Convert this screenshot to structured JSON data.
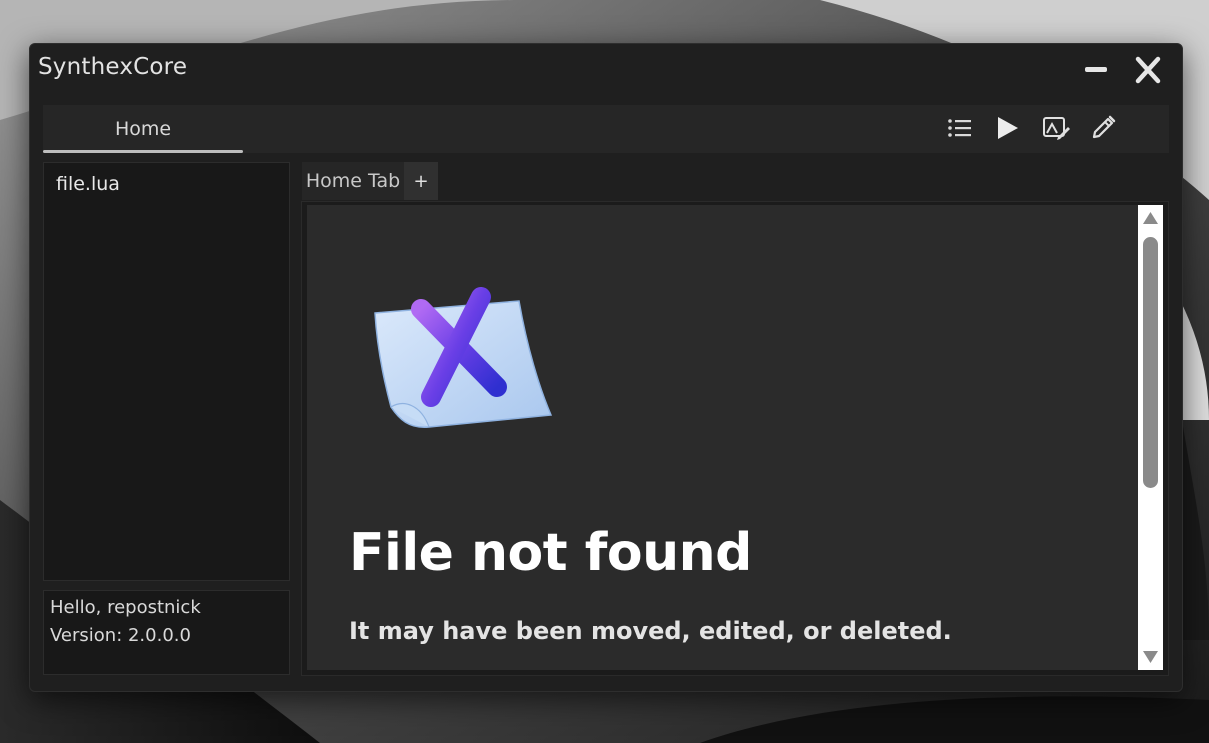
{
  "window": {
    "title": "SynthexCore"
  },
  "titlebar": {
    "minimize_icon": "minimize-icon",
    "close_icon": "close-icon"
  },
  "tabbar": {
    "home_label": "Home"
  },
  "toolbar": {
    "icons": [
      "list-icon",
      "play-icon",
      "image-edit-icon",
      "pencil-icon"
    ]
  },
  "sidebar": {
    "files": [
      {
        "name": "file.lua"
      }
    ]
  },
  "info": {
    "greeting": "Hello, repostnick",
    "version": "Version: 2.0.0.0"
  },
  "editor": {
    "tabs": [
      {
        "label": "Home Tab"
      }
    ],
    "add_tab_label": "+"
  },
  "error_page": {
    "icon": "file-not-found-icon",
    "title": "File not found",
    "message": "It may have been moved, edited, or deleted."
  },
  "colors": {
    "window_bg": "#1f1f1f",
    "panel_bg": "#181818",
    "content_bg": "#2b2b2b",
    "accent_x_start": "#a35ff0",
    "accent_x_end": "#3b2fd6"
  }
}
